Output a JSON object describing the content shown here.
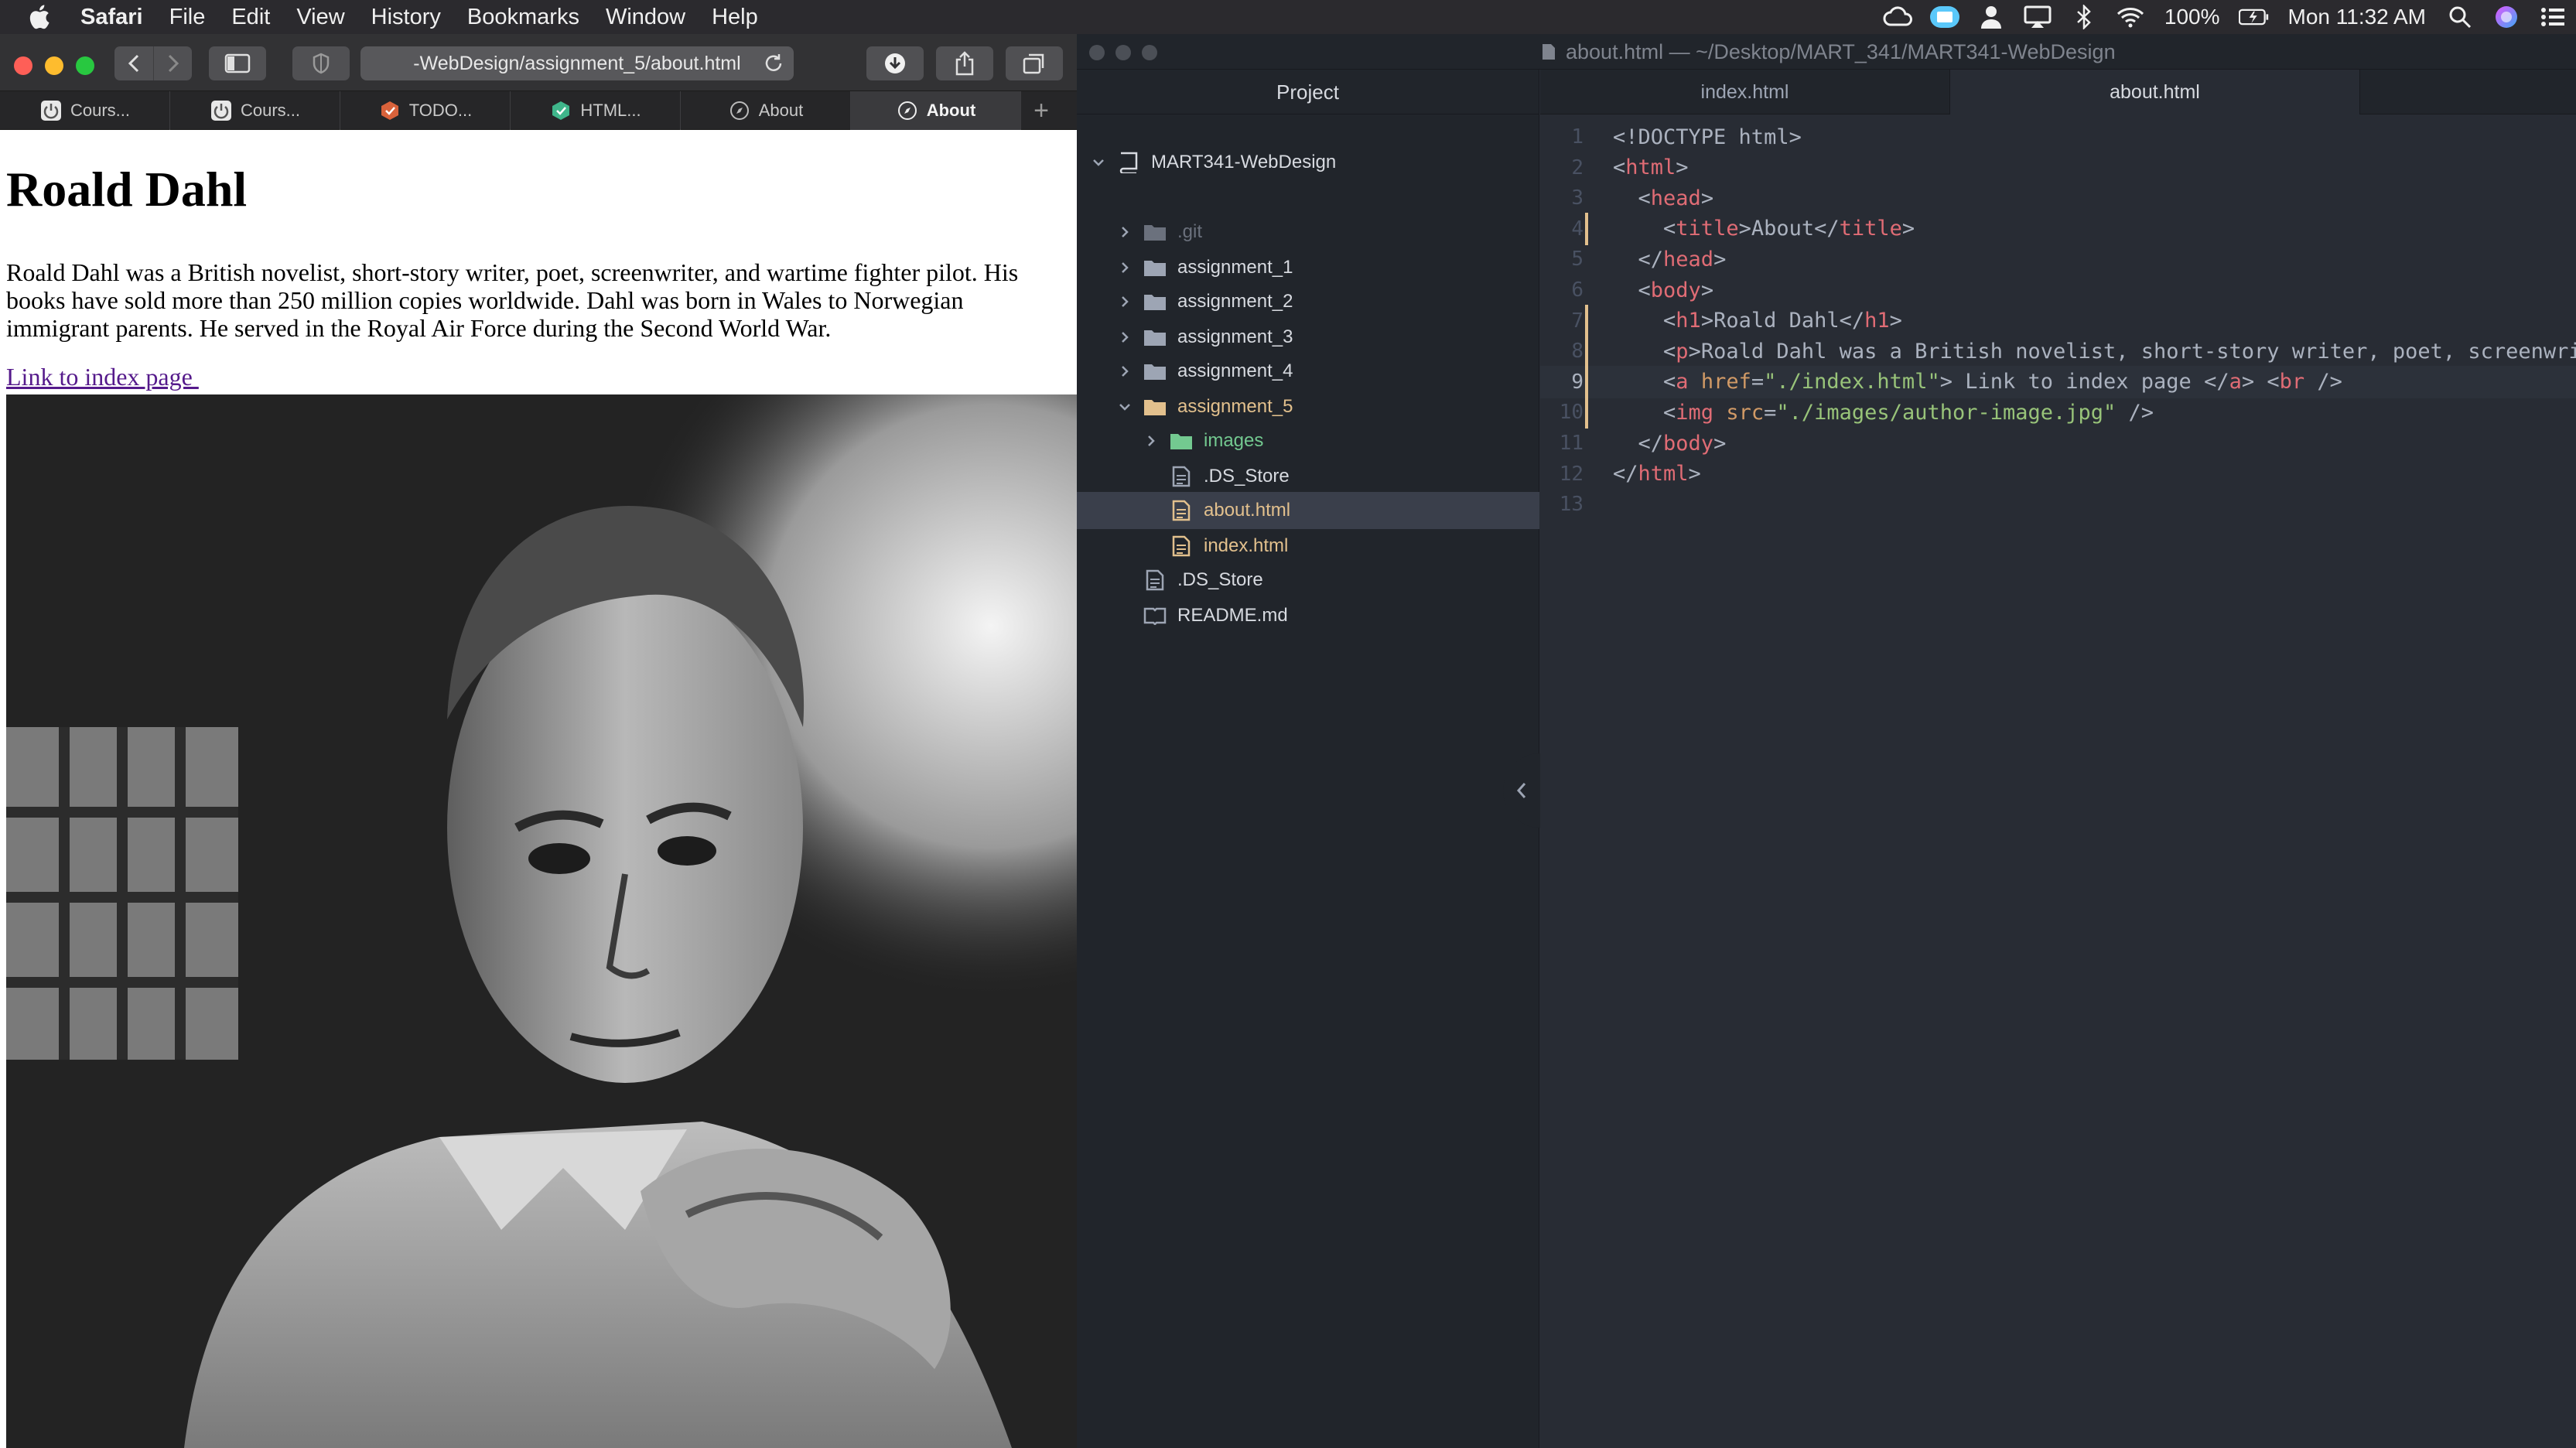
{
  "menubar": {
    "app_name": "Safari",
    "menus": [
      "File",
      "Edit",
      "View",
      "History",
      "Bookmarks",
      "Window",
      "Help"
    ],
    "battery": "100%",
    "clock": "Mon 11:32 AM",
    "tray_icons": [
      "creative-cloud-icon",
      "finder-badge-icon",
      "person-icon",
      "airplay-icon",
      "bluetooth-icon",
      "wifi-icon",
      "battery-icon",
      "search-icon",
      "siri-icon",
      "notification-list-icon"
    ]
  },
  "safari": {
    "address": "-WebDesign/assignment_5/about.html",
    "tabs": [
      {
        "label": "Cours...",
        "icon": "power-icon"
      },
      {
        "label": "Cours...",
        "icon": "power-icon"
      },
      {
        "label": "TODO...",
        "icon": "todo-icon"
      },
      {
        "label": "HTML...",
        "icon": "html-icon"
      },
      {
        "label": "About",
        "icon": "compass-icon"
      },
      {
        "label": "About",
        "icon": "compass-icon",
        "active": true
      }
    ],
    "page": {
      "heading": "Roald Dahl",
      "paragraph": "Roald Dahl was a British novelist, short-story writer, poet, screenwriter, and wartime fighter pilot. His books have sold more than 250 million copies worldwide. Dahl was born in Wales to Norwegian immigrant parents. He served in the Royal Air Force during the Second World War.",
      "link_text": "Link to index page ",
      "image_description": "author-portrait-photo"
    }
  },
  "atom": {
    "window_title": "about.html — ~/Desktop/MART_341/MART341-WebDesign",
    "tree": {
      "header": "Project",
      "items": [
        {
          "label": "MART341-WebDesign",
          "kind": "repo",
          "expanded": true
        },
        {
          "label": ".git",
          "kind": "folder",
          "dim": true
        },
        {
          "label": "assignment_1",
          "kind": "folder"
        },
        {
          "label": "assignment_2",
          "kind": "folder"
        },
        {
          "label": "assignment_3",
          "kind": "folder"
        },
        {
          "label": "assignment_4",
          "kind": "folder"
        },
        {
          "label": "assignment_5",
          "kind": "folder",
          "expanded": true,
          "modified": true
        },
        {
          "label": "images",
          "kind": "folder",
          "added": true
        },
        {
          "label": ".DS_Store",
          "kind": "file"
        },
        {
          "label": "about.html",
          "kind": "file",
          "modified": true,
          "selected": true
        },
        {
          "label": "index.html",
          "kind": "file",
          "modified": true
        },
        {
          "label": ".DS_Store",
          "kind": "file"
        },
        {
          "label": "README.md",
          "kind": "book"
        }
      ]
    },
    "editor_tabs": [
      {
        "label": "index.html"
      },
      {
        "label": "about.html",
        "active": true
      }
    ],
    "code": {
      "cursor_line": 9,
      "lines": [
        {
          "n": "1",
          "indent": 0,
          "parts": [
            {
              "t": "txt",
              "v": "<!DOCTYPE html>"
            }
          ]
        },
        {
          "n": "2",
          "indent": 0,
          "parts": [
            {
              "t": "txt",
              "v": "<"
            },
            {
              "t": "tag",
              "v": "html"
            },
            {
              "t": "txt",
              "v": ">"
            }
          ]
        },
        {
          "n": "3",
          "indent": 1,
          "parts": [
            {
              "t": "txt",
              "v": "<"
            },
            {
              "t": "tag",
              "v": "head"
            },
            {
              "t": "txt",
              "v": ">"
            }
          ]
        },
        {
          "n": "4",
          "indent": 2,
          "mod": true,
          "parts": [
            {
              "t": "txt",
              "v": "<"
            },
            {
              "t": "tag",
              "v": "title"
            },
            {
              "t": "txt",
              "v": ">About</"
            },
            {
              "t": "tag",
              "v": "title"
            },
            {
              "t": "txt",
              "v": ">"
            }
          ]
        },
        {
          "n": "5",
          "indent": 1,
          "parts": [
            {
              "t": "txt",
              "v": "</"
            },
            {
              "t": "tag",
              "v": "head"
            },
            {
              "t": "txt",
              "v": ">"
            }
          ]
        },
        {
          "n": "6",
          "indent": 1,
          "parts": [
            {
              "t": "txt",
              "v": "<"
            },
            {
              "t": "tag",
              "v": "body"
            },
            {
              "t": "txt",
              "v": ">"
            }
          ]
        },
        {
          "n": "7",
          "indent": 2,
          "mod": true,
          "parts": [
            {
              "t": "txt",
              "v": "<"
            },
            {
              "t": "tag",
              "v": "h1"
            },
            {
              "t": "txt",
              "v": ">Roald Dahl</"
            },
            {
              "t": "tag",
              "v": "h1"
            },
            {
              "t": "txt",
              "v": ">"
            }
          ]
        },
        {
          "n": "8",
          "indent": 2,
          "mod": true,
          "parts": [
            {
              "t": "txt",
              "v": "<"
            },
            {
              "t": "tag",
              "v": "p"
            },
            {
              "t": "txt",
              "v": ">Roald Dahl was a British novelist, short-story writer, poet, screenwriter, and wartime fighter pilot."
            }
          ]
        },
        {
          "n": "9",
          "indent": 2,
          "mod": true,
          "parts": [
            {
              "t": "txt",
              "v": "<"
            },
            {
              "t": "tag",
              "v": "a"
            },
            {
              "t": "txt",
              "v": " "
            },
            {
              "t": "attr",
              "v": "href"
            },
            {
              "t": "txt",
              "v": "="
            },
            {
              "t": "str",
              "v": "\"./index.html\""
            },
            {
              "t": "txt",
              "v": "> Link to index page </"
            },
            {
              "t": "tag",
              "v": "a"
            },
            {
              "t": "txt",
              "v": "> <"
            },
            {
              "t": "tag",
              "v": "br"
            },
            {
              "t": "txt",
              "v": " />"
            }
          ]
        },
        {
          "n": "10",
          "indent": 2,
          "mod": true,
          "parts": [
            {
              "t": "txt",
              "v": "<"
            },
            {
              "t": "tag",
              "v": "img"
            },
            {
              "t": "txt",
              "v": " "
            },
            {
              "t": "attr",
              "v": "src"
            },
            {
              "t": "txt",
              "v": "="
            },
            {
              "t": "str",
              "v": "\"./images/author-image.jpg\""
            },
            {
              "t": "txt",
              "v": " />"
            }
          ]
        },
        {
          "n": "11",
          "indent": 1,
          "parts": [
            {
              "t": "txt",
              "v": "</"
            },
            {
              "t": "tag",
              "v": "body"
            },
            {
              "t": "txt",
              "v": ">"
            }
          ]
        },
        {
          "n": "12",
          "indent": 0,
          "parts": [
            {
              "t": "txt",
              "v": "</"
            },
            {
              "t": "tag",
              "v": "html"
            },
            {
              "t": "txt",
              "v": ">"
            }
          ]
        },
        {
          "n": "13",
          "indent": 0,
          "parts": []
        }
      ]
    }
  },
  "colors": {
    "traffic_close": "#fe5f57",
    "traffic_min": "#febc2e",
    "traffic_max": "#28c840",
    "git_modified": "#e2c08d",
    "git_added": "#73c990",
    "link_visited": "#551a8b"
  }
}
